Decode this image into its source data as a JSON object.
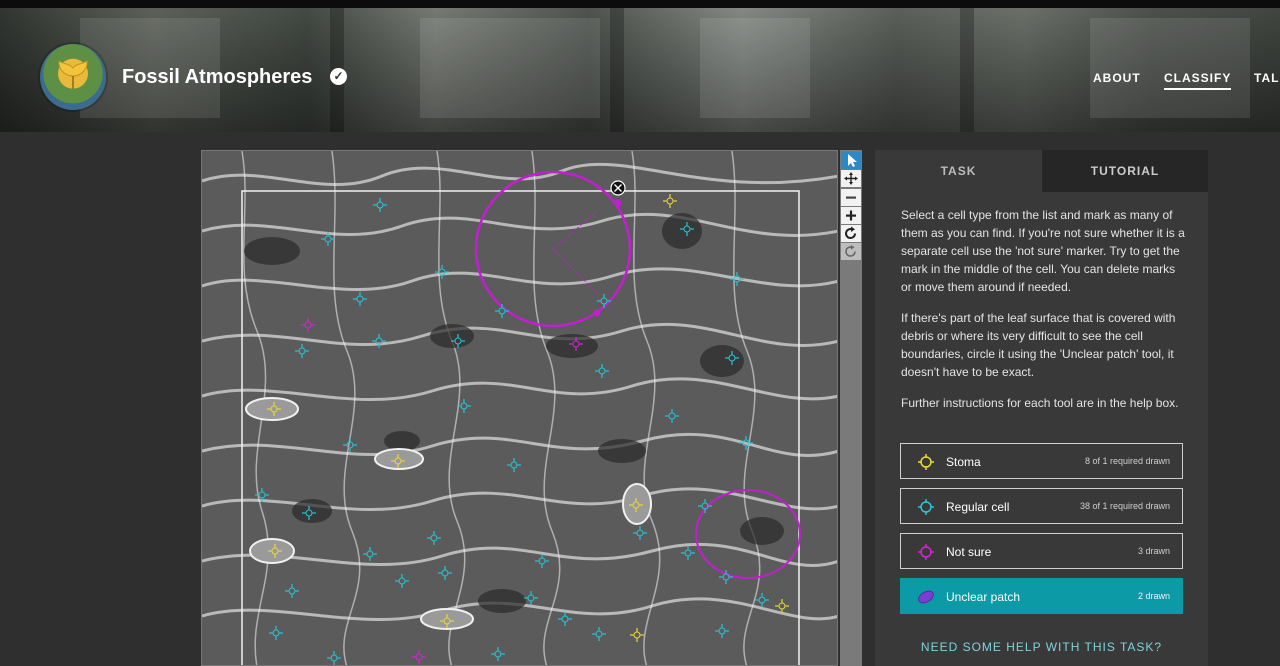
{
  "header": {
    "project_title": "Fossil Atmospheres",
    "verified_icon": "check-circle-icon",
    "nav": [
      {
        "label": "ABOUT",
        "active": false
      },
      {
        "label": "CLASSIFY",
        "active": true
      },
      {
        "label": "TALK",
        "active": false
      }
    ]
  },
  "toolbar": {
    "icons": [
      "pointer-icon",
      "move-icon",
      "zoom-out-icon",
      "zoom-in-icon",
      "rotate-icon",
      "reset-icon"
    ]
  },
  "panel": {
    "tabs": [
      {
        "label": "TASK",
        "active": true
      },
      {
        "label": "TUTORIAL",
        "active": false
      }
    ],
    "instructions": [
      "Select a cell type from the list and mark as many of them as you can find. If you're not sure whether it is a separate cell use the 'not sure' marker. Try to get the mark in the middle of the cell. You can delete marks or move them around if needed.",
      "If there's part of the leaf surface that is covered with debris or where its very difficult to see the cell boundaries, circle it using the 'Unclear patch' tool, it doesn't have to be exact.",
      "Further instructions for each tool are in the help box."
    ],
    "tools": [
      {
        "label": "Stoma",
        "count": "8 of 1 required drawn",
        "color": "#e8d73a",
        "icon": "crosshair-icon",
        "selected": false
      },
      {
        "label": "Regular cell",
        "count": "38 of 1 required drawn",
        "color": "#26c6d6",
        "icon": "crosshair-icon",
        "selected": false
      },
      {
        "label": "Not sure",
        "count": "3 drawn",
        "color": "#d524d5",
        "icon": "crosshair-icon",
        "selected": false
      },
      {
        "label": "Unclear patch",
        "count": "2 drawn",
        "color": "#7a3fd0",
        "icon": "ellipse-icon",
        "selected": true
      }
    ],
    "help_link": "NEED SOME HELP WITH THIS TASK?"
  },
  "colors": {
    "stoma": "#e8d73a",
    "regular_cell": "#26c6d6",
    "not_sure": "#d524d5",
    "unclear_patch": "#c21fd0",
    "selected_tool": "#0b9aa6"
  }
}
